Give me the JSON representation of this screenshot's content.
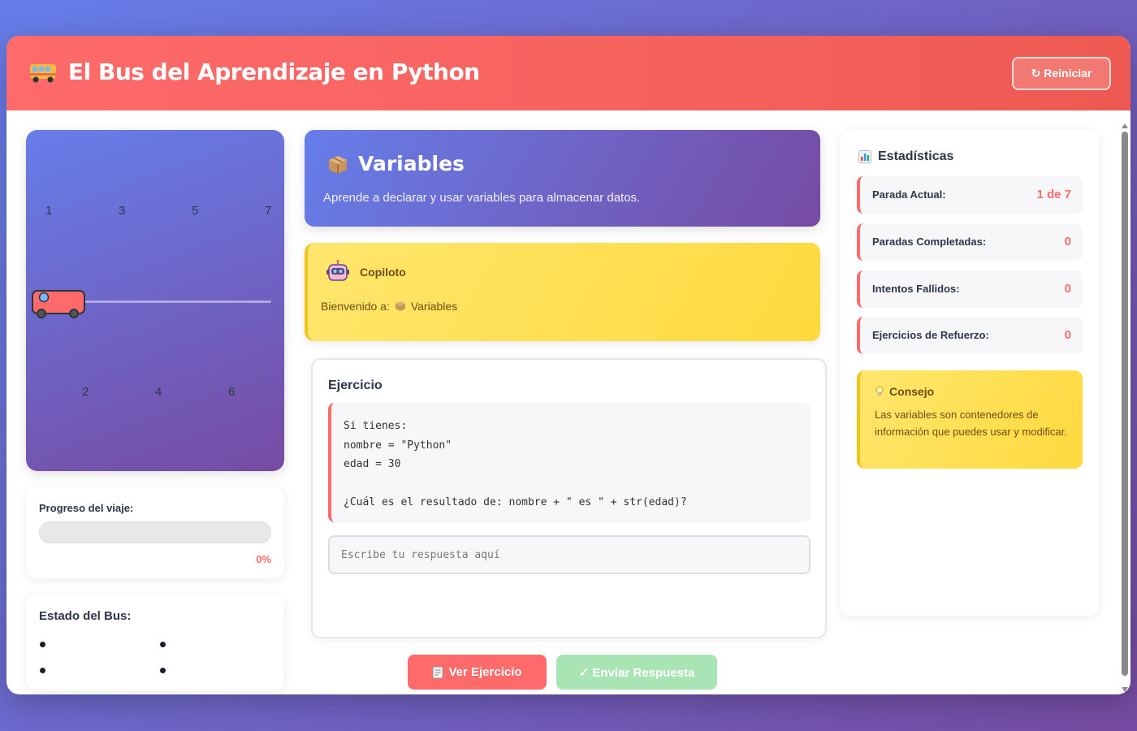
{
  "header": {
    "title": "El Bus del Aprendizaje en Python",
    "reset_label": "↻ Reiniciar"
  },
  "route": {
    "top_stops": [
      "1",
      "3",
      "5",
      "7"
    ],
    "bottom_stops": [
      "2",
      "4",
      "6"
    ]
  },
  "progress": {
    "label": "Progreso del viaje:",
    "percent_text": "0%",
    "percent": 0
  },
  "bus_status": {
    "label": "Estado del Bus:"
  },
  "topic": {
    "icon": "package-icon",
    "name": "Variables",
    "description": "Aprende a declarar y usar variables para almacenar datos."
  },
  "copilot": {
    "icon": "robot-icon",
    "name": "Copiloto",
    "welcome_prefix": "Bienvenido a:",
    "welcome_topic": "Variables"
  },
  "exercise": {
    "title": "Ejercicio",
    "code": "Si tienes:\nnombre = \"Python\"\nedad = 30\n\n¿Cuál es el resultado de: nombre + \" es \" + str(edad)?",
    "answer_value": "",
    "answer_placeholder": "Escribe tu respuesta aquí"
  },
  "actions": {
    "view_label": "Ver Ejercicio",
    "send_label": "✓ Enviar Respuesta"
  },
  "stats": {
    "title": "Estadísticas",
    "rows": [
      {
        "label": "Parada Actual:",
        "value": "1 de 7"
      },
      {
        "label": "Paradas Completadas:",
        "value": "0"
      },
      {
        "label": "Intentos Fallidos:",
        "value": "0"
      },
      {
        "label": "Ejercicios de Refuerzo:",
        "value": "0"
      }
    ]
  },
  "tip": {
    "title": "Consejo",
    "body": "Las variables son contenedores de información que puedes usar y modificar."
  },
  "colors": {
    "accent": "#ff6b6b",
    "brand_gradient_start": "#667eea",
    "brand_gradient_end": "#764ba2",
    "highlight": "#ffd93d",
    "success_disabled": "#a9e5b4"
  }
}
